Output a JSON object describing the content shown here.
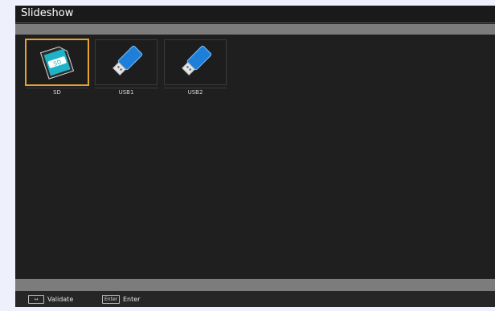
{
  "window": {
    "title": "Slideshow"
  },
  "devices": [
    {
      "label": "SD",
      "icon": "sd-card-icon",
      "selected": true
    },
    {
      "label": "USB1",
      "icon": "usb-drive-icon",
      "selected": false
    },
    {
      "label": "USB2",
      "icon": "usb-drive-icon",
      "selected": false
    }
  ],
  "footer": {
    "select_key": "↔",
    "select_label": "Validate",
    "enter_key": "Enter",
    "enter_label": "Enter"
  },
  "colors": {
    "selection": "#e7a233",
    "usb_blue": "#1e7fd9",
    "sd_green": "#1fb3c8"
  }
}
